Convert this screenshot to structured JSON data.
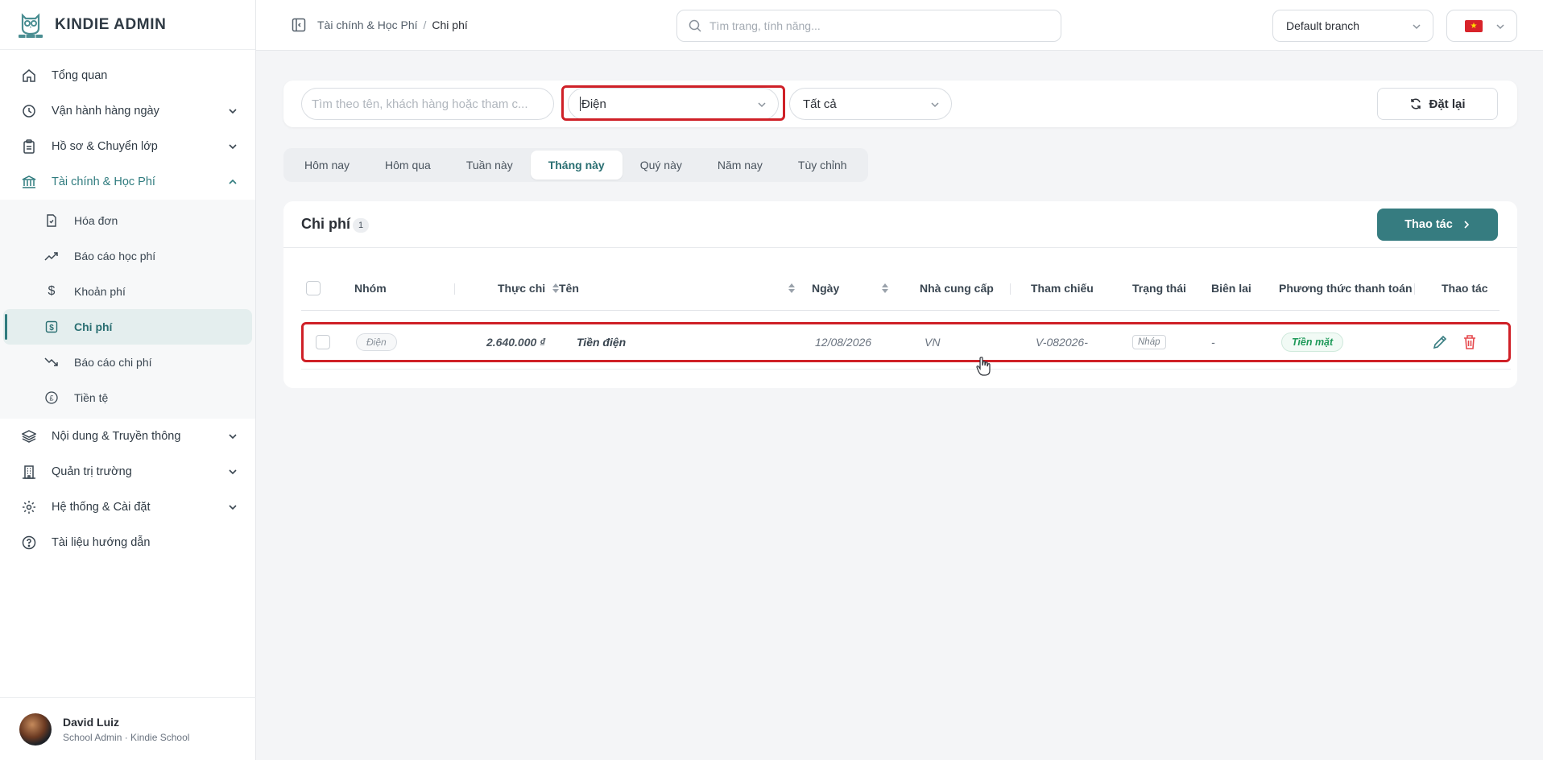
{
  "app": {
    "brand": "KINDIE ADMIN"
  },
  "sidebar": {
    "items": [
      {
        "label": "Tổng quan",
        "icon": "home-icon",
        "expandable": false
      },
      {
        "label": "Vận hành hàng ngày",
        "icon": "clock-icon",
        "expandable": true
      },
      {
        "label": "Hồ sơ & Chuyển lớp",
        "icon": "clipboard-icon",
        "expandable": true
      },
      {
        "label": "Tài chính & Học Phí",
        "icon": "bank-icon",
        "expandable": true,
        "expanded": true
      },
      {
        "label": "Nội dung & Truyền thông",
        "icon": "layers-icon",
        "expandable": true
      },
      {
        "label": "Quản trị trường",
        "icon": "building-icon",
        "expandable": true
      },
      {
        "label": "Hệ thống & Cài đặt",
        "icon": "gear-icon",
        "expandable": true
      },
      {
        "label": "Tài liệu hướng dẫn",
        "icon": "help-icon",
        "expandable": false
      }
    ],
    "finance_sub": [
      {
        "label": "Hóa đơn",
        "icon": "invoice-icon"
      },
      {
        "label": "Báo cáo học phí",
        "icon": "trend-up-icon"
      },
      {
        "label": "Khoản phí",
        "icon": "dollar-icon"
      },
      {
        "label": "Chi phí",
        "icon": "expense-icon",
        "active": true
      },
      {
        "label": "Báo cáo chi phí",
        "icon": "trend-down-icon"
      },
      {
        "label": "Tiền tệ",
        "icon": "pound-icon"
      }
    ]
  },
  "user": {
    "name": "David Luiz",
    "role": "School Admin · Kindie School"
  },
  "topbar": {
    "breadcrumb": [
      "Tài chính & Học Phí",
      "Chi phí"
    ],
    "search_placeholder": "Tìm trang, tính năng...",
    "branch": "Default branch",
    "language_flag": "vietnam-flag-icon"
  },
  "filters": {
    "search_placeholder": "Tìm theo tên, khách hàng hoặc tham c...",
    "group_value": "Điện",
    "status_value": "Tất cả",
    "reset_label": "Đặt lại"
  },
  "period_tabs": {
    "items": [
      "Hôm nay",
      "Hôm qua",
      "Tuần này",
      "Tháng này",
      "Quý này",
      "Năm nay",
      "Tùy chỉnh"
    ],
    "active": "Tháng này"
  },
  "table": {
    "title": "Chi phí",
    "count": "1",
    "action_label": "Thao tác",
    "columns": [
      "Nhóm",
      "Thực chi",
      "Tên",
      "Ngày",
      "Nhà cung cấp",
      "Tham chiếu",
      "Trạng thái",
      "Biên lai",
      "Phương thức thanh toán",
      "Thao tác"
    ],
    "rows": [
      {
        "group": "Điện",
        "amount": "2.640.000 ₫",
        "name": "Tiền điện",
        "date": "12/08/2026",
        "vendor": "VN",
        "reference": "V-082026-",
        "status": "Nháp",
        "receipt": "-",
        "payment": "Tiền mặt"
      }
    ]
  },
  "colors": {
    "accent": "#367c80",
    "highlight": "#cf2027",
    "success": "#1f9a5a",
    "danger": "#e5484d"
  }
}
